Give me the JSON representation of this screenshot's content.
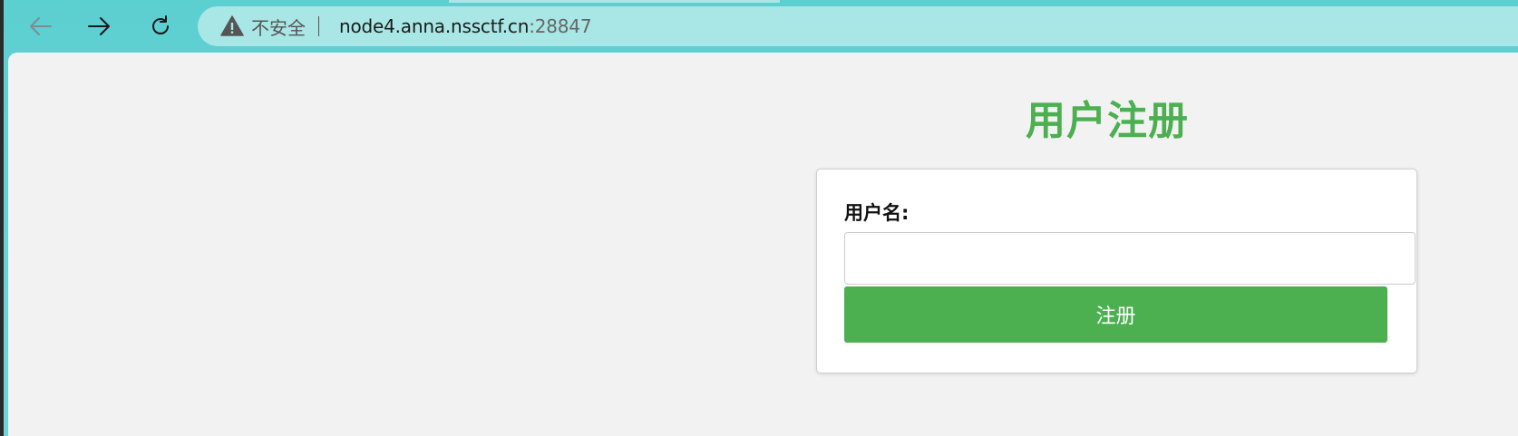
{
  "browser": {
    "nav": {
      "back_icon": "arrow-left-icon",
      "forward_icon": "arrow-right-icon",
      "reload_icon": "reload-icon"
    },
    "address_bar": {
      "security_icon": "warning-triangle-icon",
      "security_label": "不安全",
      "host": "node4.anna.nssctf.cn",
      "port": ":28847"
    }
  },
  "page": {
    "title": "用户注册",
    "form": {
      "username_label": "用户名:",
      "username_value": "",
      "submit_label": "注册"
    }
  },
  "colors": {
    "accent": "#4caf50",
    "chrome": "#5fd0d2",
    "address_bar": "#a9e6e6",
    "page_background": "#f2f2f2"
  }
}
